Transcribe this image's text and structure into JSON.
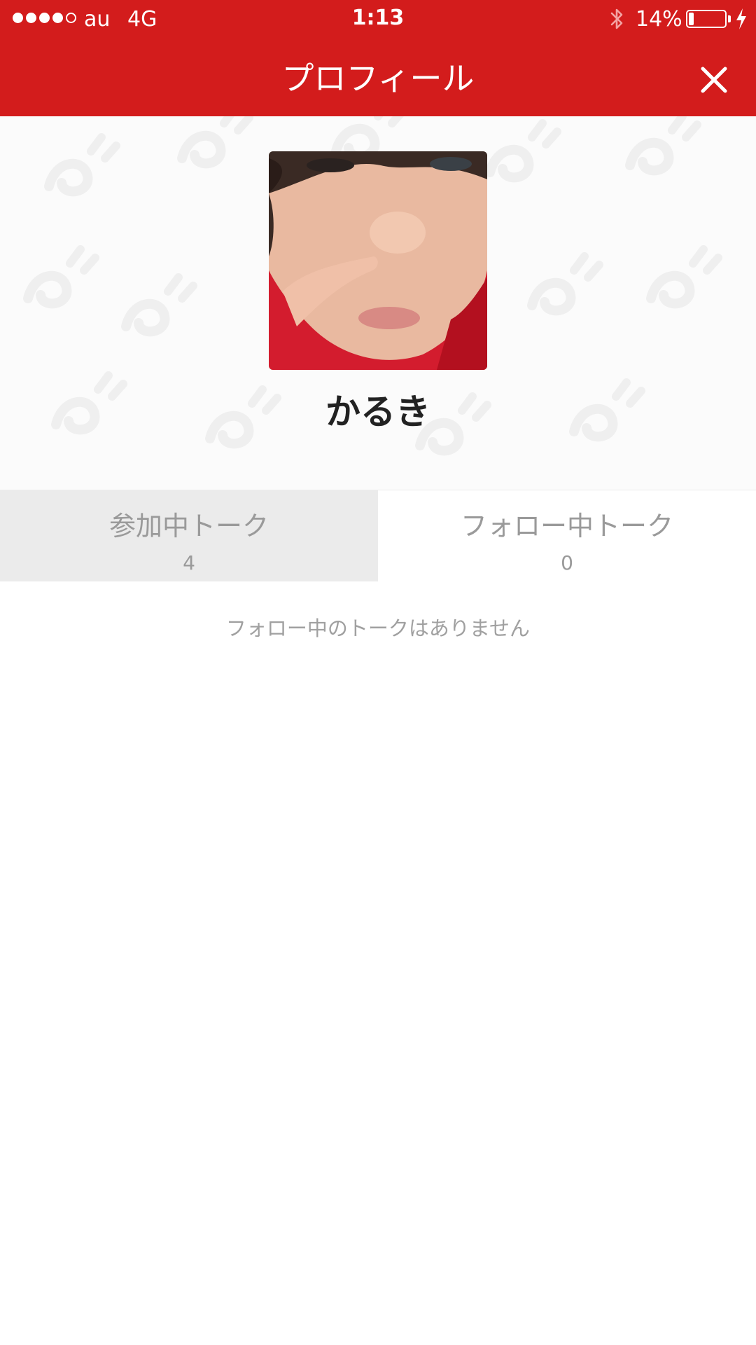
{
  "status_bar": {
    "carrier": "au",
    "network": "4G",
    "time": "1:13",
    "battery_percent": "14%",
    "battery_level": 0.14,
    "signal_strength": 4,
    "signal_max": 5
  },
  "nav": {
    "title": "プロフィール",
    "close_icon": "close-icon",
    "background_color": "#d31c1c"
  },
  "profile": {
    "username": "かるき",
    "avatar_icon": "avatar"
  },
  "tabs": [
    {
      "label": "参加中トーク",
      "count": "4",
      "selected": true
    },
    {
      "label": "フォロー中トーク",
      "count": "0",
      "selected": false
    }
  ],
  "empty_message": "フォロー中のトークはありません"
}
